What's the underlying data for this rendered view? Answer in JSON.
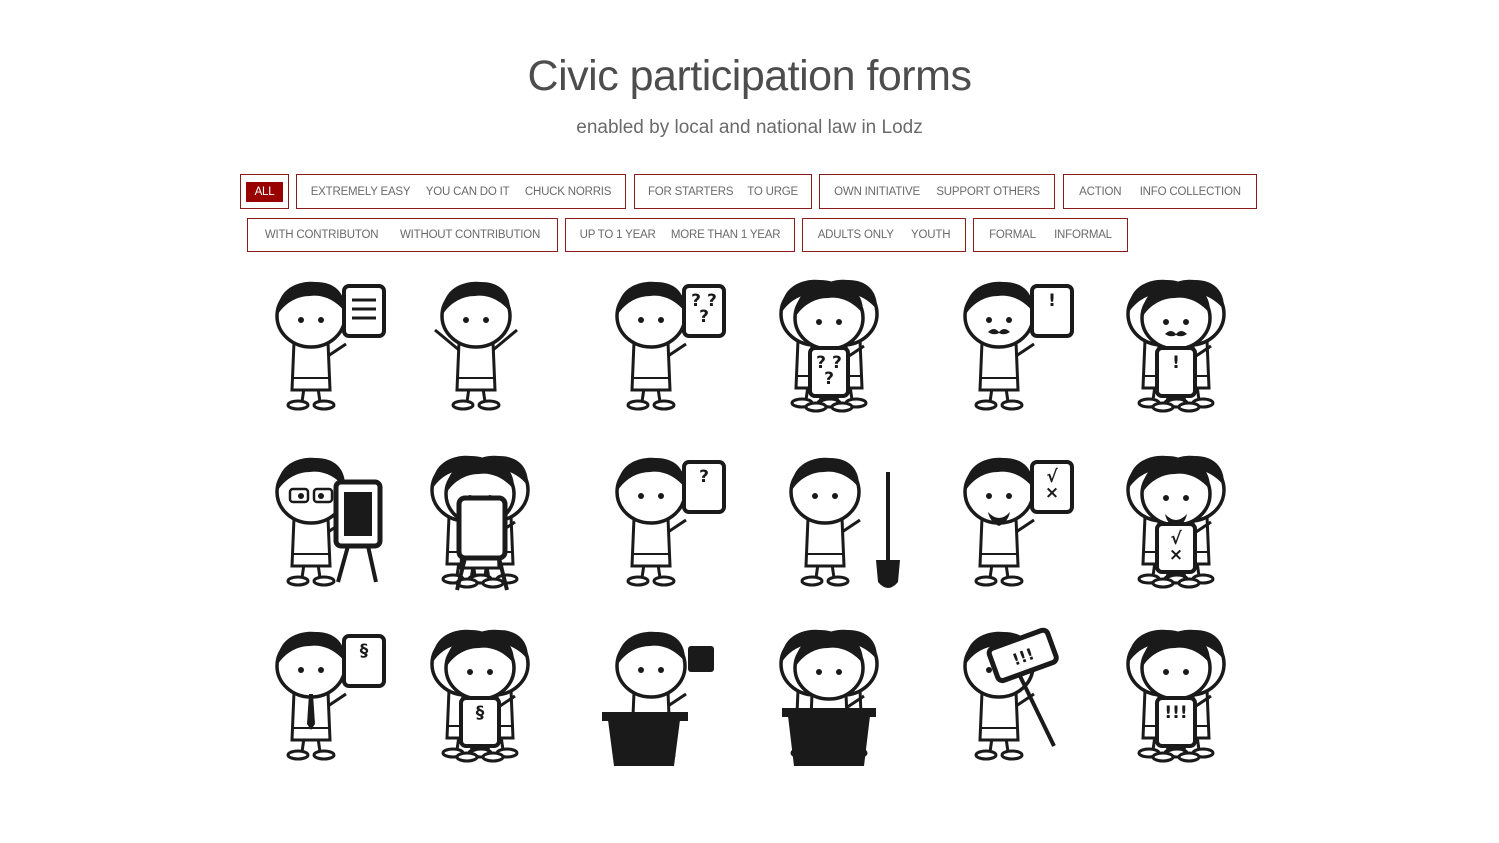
{
  "page": {
    "title": "Civic participation forms",
    "subtitle": "enabled by local and national law in Lodz"
  },
  "colors": {
    "accent": "#990000",
    "border": "#8b1a1a",
    "ink": "#1a1a1a"
  },
  "filters": {
    "row1": [
      {
        "items": [
          {
            "label": "ALL",
            "active": true
          }
        ]
      },
      {
        "items": [
          {
            "label": "EXTREMELY EASY"
          },
          {
            "label": "YOU CAN DO IT"
          },
          {
            "label": "CHUCK NORRIS"
          }
        ]
      },
      {
        "items": [
          {
            "label": "FOR STARTERS"
          },
          {
            "label": "TO URGE"
          }
        ]
      },
      {
        "items": [
          {
            "label": "OWN INITIATIVE"
          },
          {
            "label": "SUPPORT OTHERS"
          }
        ]
      },
      {
        "items": [
          {
            "label": "ACTION"
          },
          {
            "label": "INFO COLLECTION"
          }
        ]
      }
    ],
    "row2": [
      {
        "items": [
          {
            "label": "WITH CONTRIBUTON"
          },
          {
            "label": "WITHOUT CONTRIBUTION"
          }
        ]
      },
      {
        "items": [
          {
            "label": "UP TO 1 YEAR"
          },
          {
            "label": "MORE THAN 1 YEAR"
          }
        ]
      },
      {
        "items": [
          {
            "label": "ADULTS ONLY"
          },
          {
            "label": "YOUTH"
          }
        ]
      },
      {
        "items": [
          {
            "label": "FORMAL"
          },
          {
            "label": "INFORMAL"
          }
        ]
      }
    ]
  },
  "figures": {
    "r0c0": {
      "icon": "person-with-document-icon",
      "sign_text": ""
    },
    "r0c1": {
      "icon": "person-arms-raised-icon",
      "sign_text": ""
    },
    "r0c2": {
      "icon": "person-with-questions-sign-icon",
      "sign_text": "? ?\n?"
    },
    "r0c3": {
      "icon": "group-with-questions-sign-icon",
      "sign_text": "? ?\n?"
    },
    "r0c4": {
      "icon": "mustache-person-exclamation-sign-icon",
      "sign_text": "!"
    },
    "r0c5": {
      "icon": "group-mustache-exclamation-sign-icon",
      "sign_text": "!"
    },
    "r1c0": {
      "icon": "glasses-person-easel-icon",
      "sign_text": ""
    },
    "r1c1": {
      "icon": "group-easel-icon",
      "sign_text": ""
    },
    "r1c2": {
      "icon": "person-question-sign-icon",
      "sign_text": "?"
    },
    "r1c3": {
      "icon": "person-with-shovel-icon",
      "sign_text": ""
    },
    "r1c4": {
      "icon": "bearded-person-vote-sign-icon",
      "sign_text": "√\n×"
    },
    "r1c5": {
      "icon": "group-bearded-vote-sign-icon",
      "sign_text": "√\n×"
    },
    "r2c0": {
      "icon": "tie-person-paragraph-sign-icon",
      "sign_text": "§"
    },
    "r2c1": {
      "icon": "group-paragraph-sign-icon",
      "sign_text": "§"
    },
    "r2c2": {
      "icon": "speaker-at-podium-icon",
      "sign_text": ""
    },
    "r2c3": {
      "icon": "group-at-podium-icon",
      "sign_text": ""
    },
    "r2c4": {
      "icon": "protester-with-placard-icon",
      "sign_text": "!!!"
    },
    "r2c5": {
      "icon": "group-protest-sign-icon",
      "sign_text": "!!!"
    }
  }
}
